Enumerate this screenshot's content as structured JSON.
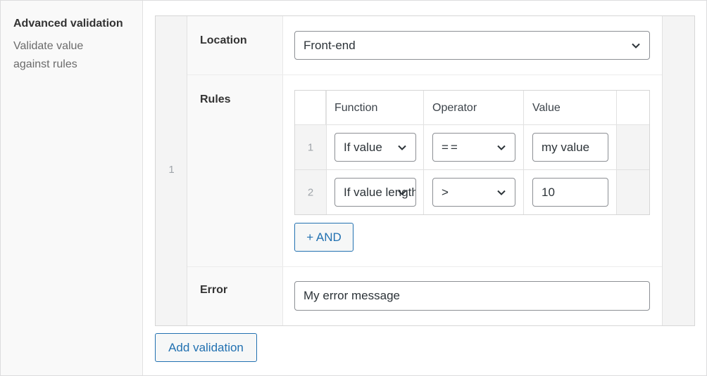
{
  "field": {
    "title": "Advanced validation",
    "description": "Validate value against rules"
  },
  "repeater": {
    "row_number": "1",
    "location": {
      "label": "Location",
      "selected": "Front-end"
    },
    "rules": {
      "label": "Rules",
      "columns": [
        "Function",
        "Operator",
        "Value"
      ],
      "rows": [
        {
          "order": "1",
          "function": "If value",
          "operator": "==",
          "value": "my value"
        },
        {
          "order": "2",
          "function": "If value length",
          "operator": ">",
          "value": "10"
        }
      ],
      "and_button": "+ AND"
    },
    "error": {
      "label": "Error",
      "value": "My error message"
    }
  },
  "add_button": "Add validation"
}
